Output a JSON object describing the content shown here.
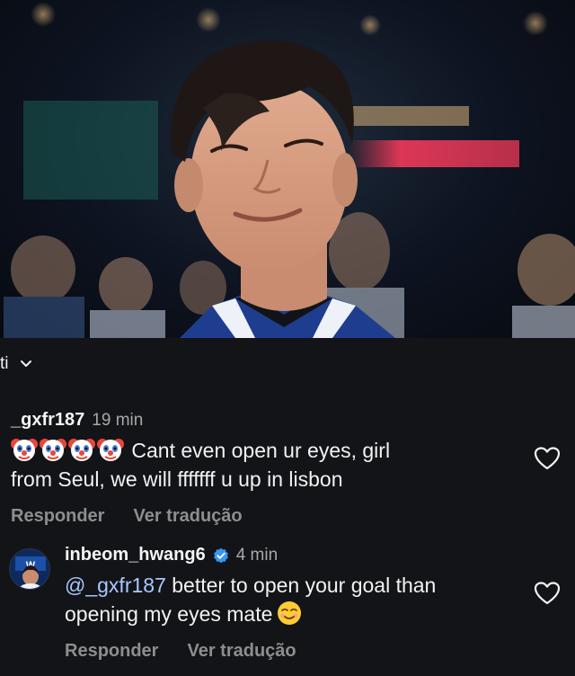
{
  "header": {
    "label": "ti",
    "dropdown_icon": "chevron-down-icon"
  },
  "comments": [
    {
      "username": "_gxfr187",
      "time": "19 min",
      "emoji": [
        "clown-face",
        "clown-face",
        "clown-face",
        "clown-face"
      ],
      "text_line1": "Cant even open ur eyes, girl",
      "text_line2": "from Seul, we will fffffff u up in lisbon",
      "reply_label": "Responder",
      "translate_label": "Ver tradução"
    },
    {
      "username": "inbeom_hwang6",
      "verified": true,
      "time": "4 min",
      "mention": "@_gxfr187",
      "text_line1": " better to open your goal than",
      "text_line2": "opening my eyes mate",
      "trailing_emoji": "smiling-face",
      "reply_label": "Responder",
      "translate_label": "Ver tradução"
    }
  ],
  "colors": {
    "background": "#131418",
    "mention": "#a9c7ff",
    "verified": "#3897f0",
    "secondary_text": "#8e8e8e"
  }
}
